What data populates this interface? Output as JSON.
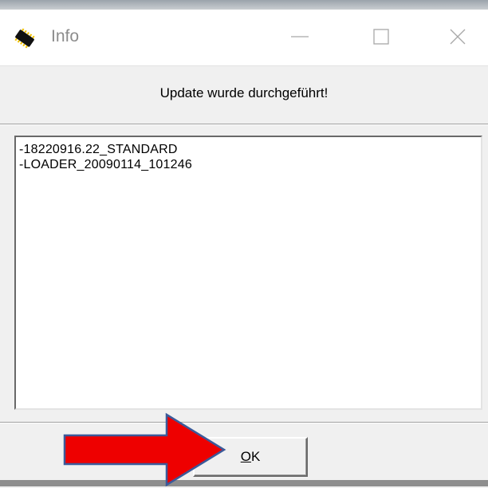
{
  "window": {
    "title": "Info",
    "icon": "chip-icon",
    "controls": {
      "minimize": "minimize-icon",
      "maximize": "maximize-icon",
      "close": "close-icon"
    }
  },
  "dialog": {
    "message": "Update wurde durchgeführt!",
    "items": [
      "-18220916.22_STANDARD",
      "-LOADER_20090114_101246"
    ],
    "ok_mnemonic": "O",
    "ok_rest": "K"
  },
  "annotation": {
    "type": "red-arrow-icon",
    "color": "#ee0000",
    "outline": "#3b5a9a"
  }
}
